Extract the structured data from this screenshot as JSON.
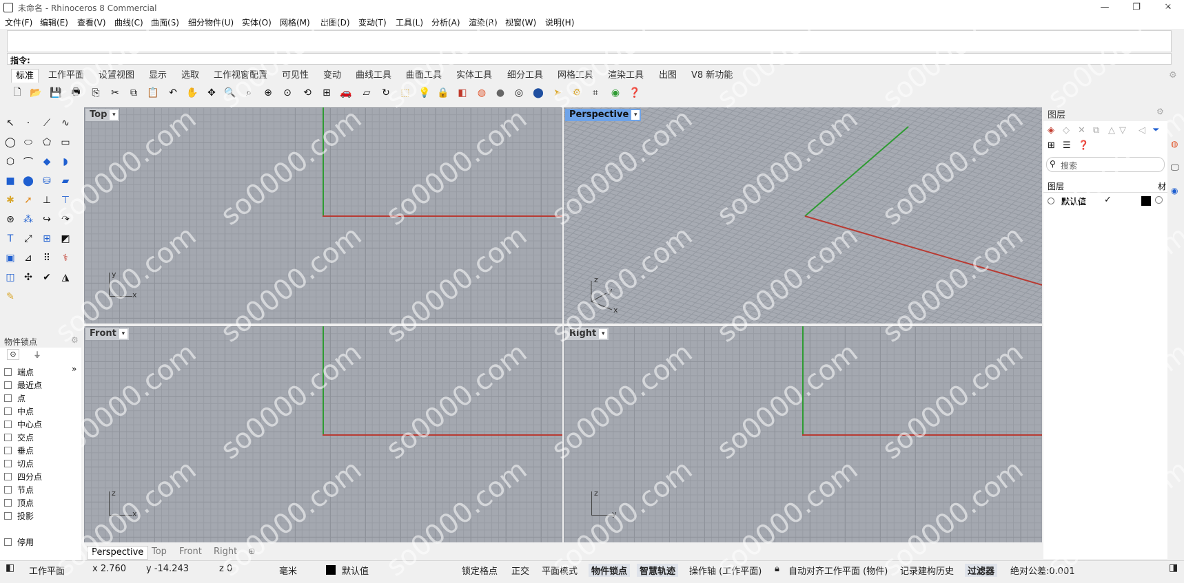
{
  "window": {
    "title": "未命名 - Rhinoceros 8 Commercial",
    "minimize": "—",
    "restore": "❐",
    "close": "✕"
  },
  "menu": [
    "文件(F)",
    "编辑(E)",
    "查看(V)",
    "曲线(C)",
    "曲面(S)",
    "细分物件(U)",
    "实体(O)",
    "网格(M)",
    "出图(D)",
    "变动(T)",
    "工具(L)",
    "分析(A)",
    "渲染(R)",
    "视窗(W)",
    "说明(H)"
  ],
  "command": {
    "prompt": "指令:"
  },
  "toolbar_tabs": [
    "标准",
    "工作平面",
    "设置视图",
    "显示",
    "选取",
    "工作视窗配置",
    "可见性",
    "变动",
    "曲线工具",
    "曲面工具",
    "实体工具",
    "细分工具",
    "网格工具",
    "渲染工具",
    "出图",
    "V8 新功能"
  ],
  "toolbar_icons": [
    "new-icon",
    "open-icon",
    "save-icon",
    "print-icon",
    "import-icon",
    "cut-icon",
    "copy-icon",
    "paste-icon",
    "undo-icon",
    "pan-icon",
    "rotate-view-icon",
    "zoom-icon",
    "zoom-window-icon",
    "zoom-extents-icon",
    "zoom-selected-icon",
    "rotate-icon",
    "four-viewports-icon",
    "car-icon",
    "plane-icon",
    "rotate-camera-icon",
    "select-icon",
    "light-icon",
    "lock-icon",
    "layer-icon",
    "color-wheel-icon",
    "shaded-sphere-icon",
    "wireframe-sphere-icon",
    "render-sphere-icon",
    "pointer-icon",
    "settings-gear-icon",
    "grid-snap-icon",
    "green-globe-icon",
    "help-icon"
  ],
  "viewports": {
    "top": {
      "label": "Top",
      "axis_x": "x",
      "axis_y": "y"
    },
    "perspective": {
      "label": "Perspective",
      "axis_x": "x",
      "axis_y": "y",
      "axis_z": "z"
    },
    "front": {
      "label": "Front",
      "axis_x": "x",
      "axis_z": "z"
    },
    "right": {
      "label": "Right",
      "axis_y": "y",
      "axis_z": "z"
    }
  },
  "osnap": {
    "title": "物件锁点",
    "items": [
      "端点",
      "最近点",
      "点",
      "中点",
      "中心点",
      "交点",
      "垂点",
      "切点",
      "四分点",
      "节点",
      "顶点",
      "投影"
    ],
    "disable": "停用"
  },
  "viewport_tabs": [
    "Perspective",
    "Top",
    "Front",
    "Right"
  ],
  "status": {
    "plane": "工作平面",
    "x": "x 2.760",
    "y": "y -14.243",
    "z": "z 0",
    "units": "毫米",
    "layer": "默认值",
    "grid_snap": "锁定格点",
    "ortho": "正交",
    "planar": "平面模式",
    "osnap": "物件锁点",
    "smarttrack": "智慧轨迹",
    "gumball": "操作轴 (工作平面)",
    "autoalign": "自动对齐工作平面 (物件)",
    "history": "记录建构历史",
    "filter": "过滤器",
    "tolerance": "绝对公差:0.001"
  },
  "layers": {
    "title": "图层",
    "search_placeholder": "搜索",
    "col_layer": "图层",
    "col_material": "材",
    "default_layer": "默认值",
    "current_check": "✓"
  },
  "watermark": "so0000.com",
  "colors": {
    "active_viewport": "#6ea3e8",
    "x_axis": "#b83a32",
    "y_axis": "#2e9b32",
    "viewport_bg": "#a4a8b0"
  }
}
